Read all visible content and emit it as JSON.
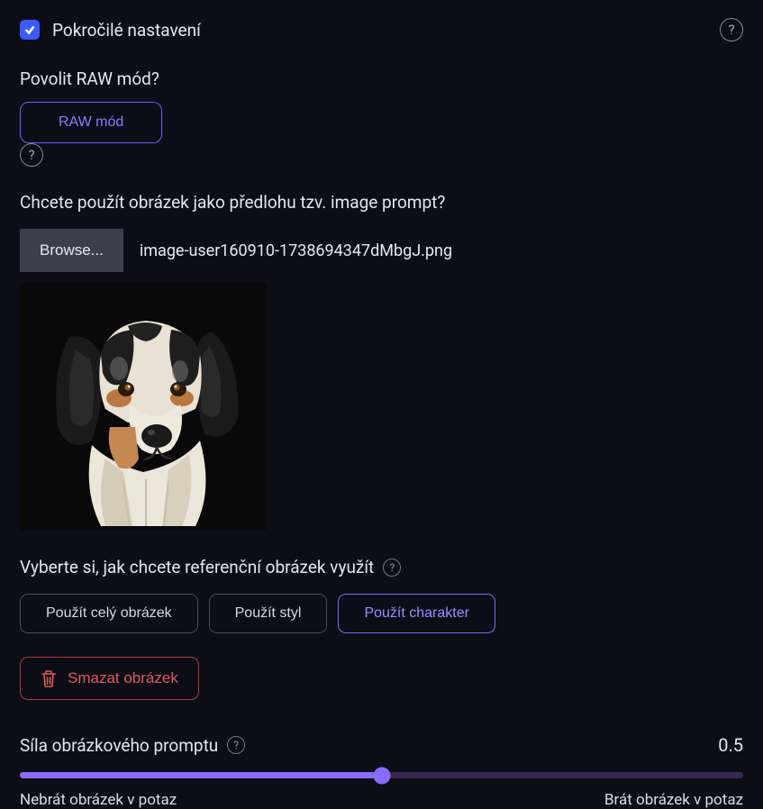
{
  "advanced": {
    "label": "Pokročilé nastavení",
    "checked": true
  },
  "raw": {
    "question": "Povolit RAW mód?",
    "button": "RAW mód"
  },
  "imagePrompt": {
    "question": "Chcete použít obrázek jako předlohu tzv. image prompt?",
    "browse": "Browse...",
    "filename": "image-user160910-1738694347dMbgJ.png"
  },
  "reference": {
    "label": "Vyberte si, jak chcete referenční obrázek využít",
    "options": {
      "whole": "Použít celý obrázek",
      "style": "Použít styl",
      "character": "Použít charakter"
    },
    "delete": "Smazat obrázek"
  },
  "strength": {
    "label": "Síla obrázkového promptu",
    "value": "0.5",
    "min": "Nebrát obrázek v potaz",
    "max": "Brát obrázek v potaz"
  }
}
